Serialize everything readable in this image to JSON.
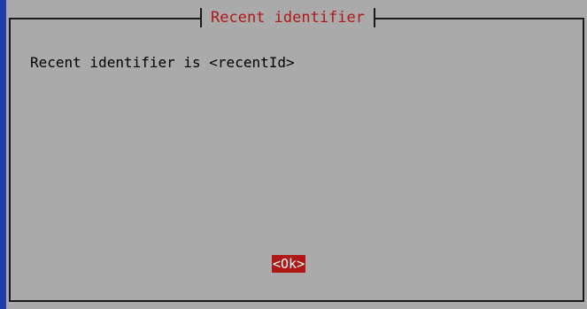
{
  "dialog": {
    "title": "Recent identifier",
    "message": "Recent identifier is <recentId>",
    "ok_label": "<Ok>"
  },
  "colors": {
    "screen_bg": "#1f3fa6",
    "dialog_bg": "#aaaaaa",
    "title_text": "#b01818",
    "button_bg": "#b01818",
    "button_text": "#ffffff"
  }
}
